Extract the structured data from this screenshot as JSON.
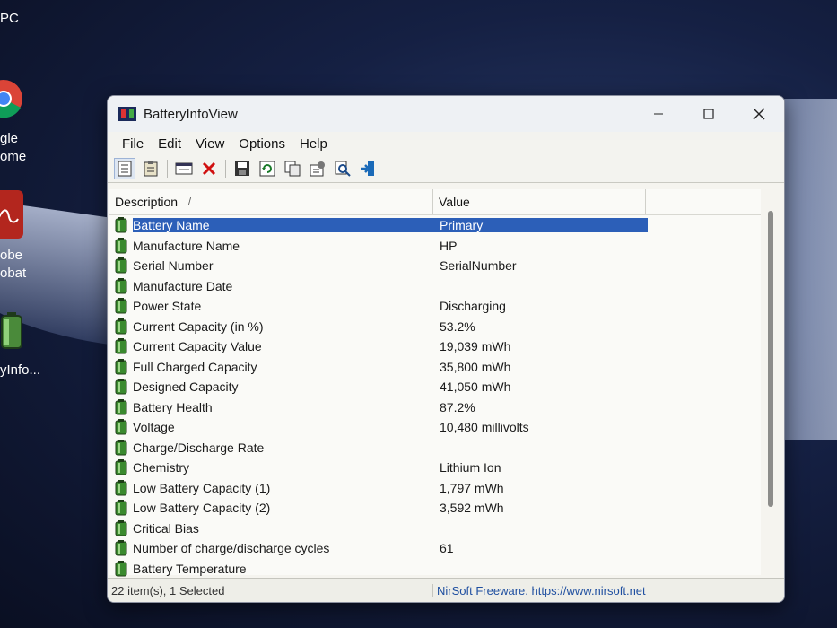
{
  "desktop": {
    "texts": [
      "PC",
      "gle",
      "ome",
      "obe",
      "obat",
      "yInfo..."
    ]
  },
  "window": {
    "title": "BatteryInfoView",
    "menu": [
      "File",
      "Edit",
      "View",
      "Options",
      "Help"
    ],
    "toolbar_icons": [
      "properties-icon",
      "clipboard-icon",
      "html-report-icon",
      "delete-icon",
      "save-icon",
      "refresh-icon",
      "copy-icon",
      "advanced-options-icon",
      "find-icon",
      "exit-icon"
    ]
  },
  "columns": {
    "description": "Description",
    "sort_mark": "/",
    "value": "Value"
  },
  "rows": [
    {
      "description": "Battery Name",
      "value": "Primary",
      "selected": true
    },
    {
      "description": "Manufacture Name",
      "value": "HP"
    },
    {
      "description": "Serial Number",
      "value": "SerialNumber"
    },
    {
      "description": "Manufacture Date",
      "value": ""
    },
    {
      "description": "Power State",
      "value": "Discharging"
    },
    {
      "description": "Current Capacity (in %)",
      "value": "53.2%"
    },
    {
      "description": "Current Capacity Value",
      "value": "19,039 mWh"
    },
    {
      "description": "Full Charged Capacity",
      "value": "35,800 mWh"
    },
    {
      "description": "Designed Capacity",
      "value": "41,050 mWh"
    },
    {
      "description": "Battery Health",
      "value": "87.2%"
    },
    {
      "description": "Voltage",
      "value": "10,480 millivolts"
    },
    {
      "description": "Charge/Discharge Rate",
      "value": ""
    },
    {
      "description": "Chemistry",
      "value": "Lithium Ion"
    },
    {
      "description": "Low Battery Capacity (1)",
      "value": "1,797 mWh"
    },
    {
      "description": "Low Battery Capacity (2)",
      "value": "3,592 mWh"
    },
    {
      "description": "Critical Bias",
      "value": ""
    },
    {
      "description": "Number of charge/discharge cycles",
      "value": "61"
    },
    {
      "description": "Battery Temperature",
      "value": ""
    }
  ],
  "status": {
    "items": "22 item(s), 1 Selected",
    "credit": "NirSoft Freeware. https://www.nirsoft.net"
  },
  "colors": {
    "selection": "#2c5fb8",
    "credit_link": "#1f4fa0",
    "battery_green": "#3a8a2e"
  }
}
